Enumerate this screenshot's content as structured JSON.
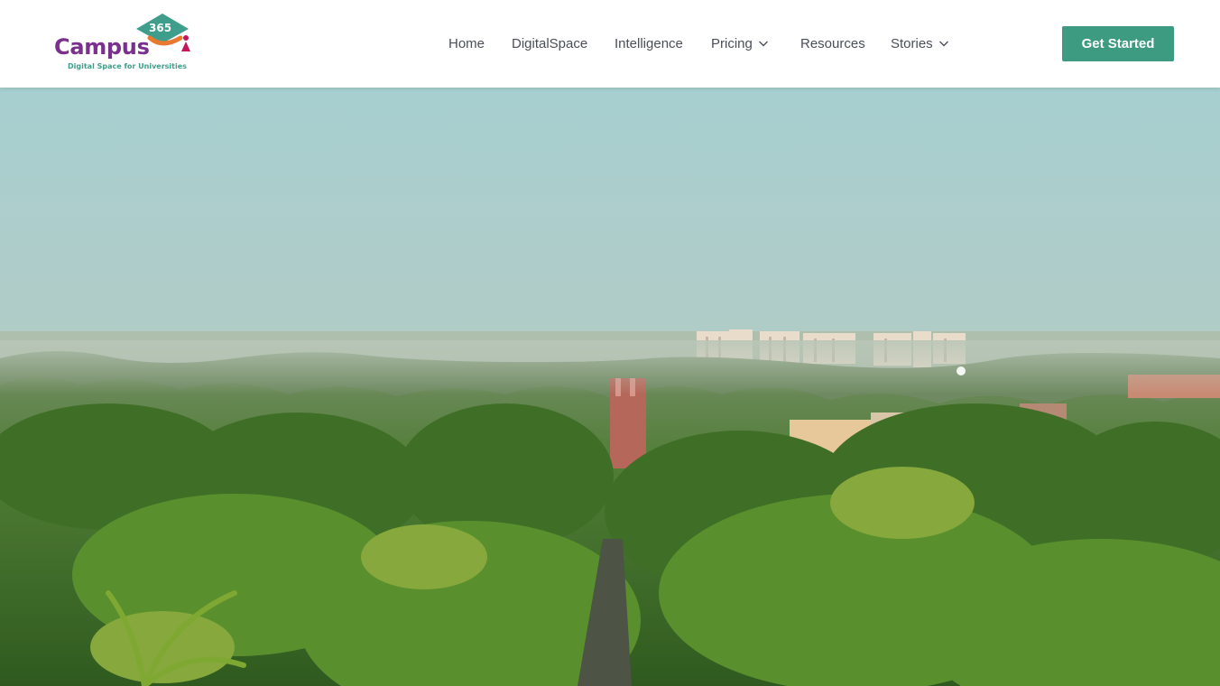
{
  "brand": {
    "name": "Campus",
    "number": "365",
    "tagline": "Digital Space for Universities"
  },
  "nav": {
    "items": [
      {
        "label": "Home",
        "has_dropdown": false
      },
      {
        "label": "DigitalSpace",
        "has_dropdown": false
      },
      {
        "label": "Intelligence",
        "has_dropdown": false
      },
      {
        "label": "Pricing",
        "has_dropdown": true
      },
      {
        "label": "Resources",
        "has_dropdown": false
      },
      {
        "label": "Stories",
        "has_dropdown": true
      }
    ]
  },
  "cta": {
    "label": "Get Started"
  },
  "colors": {
    "brand_purple": "#7b2f8e",
    "brand_teal": "#3f9e8b",
    "cta_green": "#3d9b82",
    "nav_text": "#4a4f57"
  },
  "hero": {
    "media": "campus-aerial-video"
  }
}
